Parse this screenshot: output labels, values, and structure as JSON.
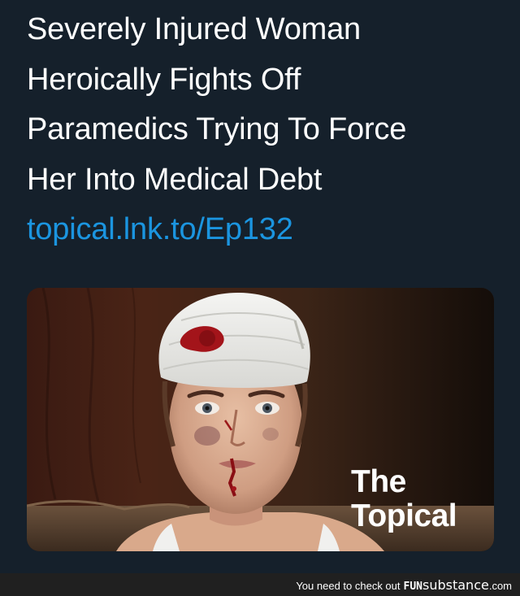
{
  "tweet": {
    "lines": [
      "Severely Injured Woman",
      "Heroically Fights Off",
      "Paramedics Trying To Force",
      "Her Into Medical Debt"
    ],
    "link": "topical.lnk.to/Ep132"
  },
  "card": {
    "image_alt": "woman-with-bandaged-head",
    "brand_line1": "The",
    "brand_line2": "Topical"
  },
  "footer": {
    "prefix": "You need to check out",
    "brand_part1": "FUN",
    "brand_part2": "substance",
    "brand_suffix": ".com"
  },
  "colors": {
    "background": "#15202b",
    "link": "#1b95e0",
    "text": "#ffffff",
    "footer_bg": "#202020"
  }
}
